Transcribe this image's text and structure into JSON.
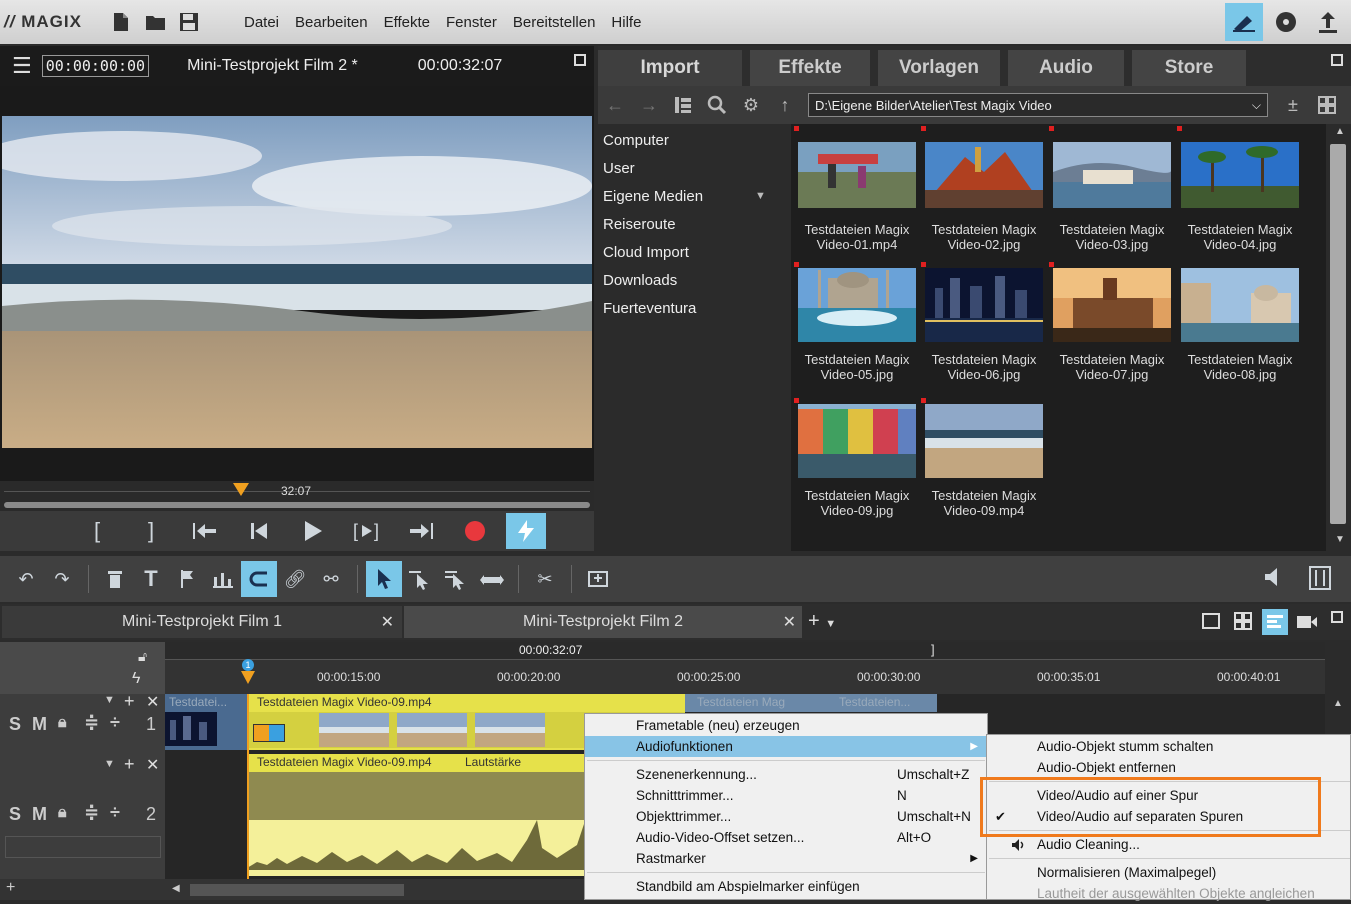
{
  "menubar": {
    "logo": "MAGIX",
    "items": [
      "Datei",
      "Bearbeiten",
      "Effekte",
      "Fenster",
      "Bereitstellen",
      "Hilfe"
    ]
  },
  "preview": {
    "timecode_position": "00:00:00:00",
    "project_title": "Mini-Testprojekt Film 2 *",
    "timecode_length": "00:00:32:07",
    "scrub_time": "32:07"
  },
  "pool": {
    "tabs": [
      "Import",
      "Effekte",
      "Vorlagen",
      "Audio",
      "Store"
    ],
    "path": "D:\\Eigene Bilder\\Atelier\\Test Magix Video",
    "sidebar": [
      "Computer",
      "User",
      "Eigene Medien",
      "Reiseroute",
      "Cloud Import",
      "Downloads",
      "Fuerteventura"
    ],
    "files": [
      {
        "line1": "Testdateien Magix",
        "line2": "Video-01.mp4"
      },
      {
        "line1": "Testdateien Magix",
        "line2": "Video-02.jpg"
      },
      {
        "line1": "Testdateien Magix",
        "line2": "Video-03.jpg"
      },
      {
        "line1": "Testdateien Magix",
        "line2": "Video-04.jpg"
      },
      {
        "line1": "Testdateien Magix",
        "line2": "Video-05.jpg"
      },
      {
        "line1": "Testdateien Magix",
        "line2": "Video-06.jpg"
      },
      {
        "line1": "Testdateien Magix",
        "line2": "Video-07.jpg"
      },
      {
        "line1": "Testdateien Magix",
        "line2": "Video-08.jpg"
      },
      {
        "line1": "Testdateien Magix",
        "line2": "Video-09.jpg"
      },
      {
        "line1": "Testdateien Magix",
        "line2": "Video-09.mp4"
      }
    ]
  },
  "project_tabs": [
    "Mini-Testprojekt Film 1",
    "Mini-Testprojekt Film 2"
  ],
  "timeline": {
    "end_marker": "00:00:32:07",
    "ruler": [
      "00:00:15:00",
      "00:00:20:00",
      "00:00:25:00",
      "00:00:30:00",
      "00:00:35:01",
      "00:00:40:01"
    ],
    "marker_number": "1",
    "track1_number": "1",
    "track2_number": "2",
    "clip_left": "Testdatei...",
    "clip_video": "Testdateien Magix Video-09.mp4",
    "clip_right1": "Testdateien Mag",
    "clip_right2": "Testdateien...",
    "clip_audio": "Testdateien Magix Video-09.mp4",
    "clip_audio_volume": "Lautstärke",
    "track_solo": "S",
    "track_mute": "M"
  },
  "context_menu": {
    "items": [
      {
        "label": "Frametable (neu) erzeugen",
        "shortcut": ""
      },
      {
        "label": "Audiofunktionen",
        "shortcut": ""
      },
      {
        "label": "Szenenerkennung...",
        "shortcut": "Umschalt+Z"
      },
      {
        "label": "Schnitttrimmer...",
        "shortcut": "N"
      },
      {
        "label": "Objekttrimmer...",
        "shortcut": "Umschalt+N"
      },
      {
        "label": "Audio-Video-Offset setzen...",
        "shortcut": "Alt+O"
      },
      {
        "label": "Rastmarker",
        "shortcut": ""
      },
      {
        "label": "Standbild am Abspielmarker einfügen",
        "shortcut": ""
      }
    ]
  },
  "sub_menu": {
    "items": [
      {
        "label": "Audio-Objekt stumm schalten"
      },
      {
        "label": "Audio-Objekt entfernen"
      },
      {
        "label": "Video/Audio auf einer Spur"
      },
      {
        "label": "Video/Audio auf separaten Spuren"
      },
      {
        "label": "Audio Cleaning..."
      },
      {
        "label": "Normalisieren (Maximalpegel)"
      },
      {
        "label": "Lautheit der ausgewählten Objekte angleichen"
      }
    ]
  },
  "colors": {
    "accent": "#7ac7e8",
    "highlight_box": "#f07a1c",
    "clip_yellow": "#e6e14a",
    "record": "#e8383d"
  }
}
